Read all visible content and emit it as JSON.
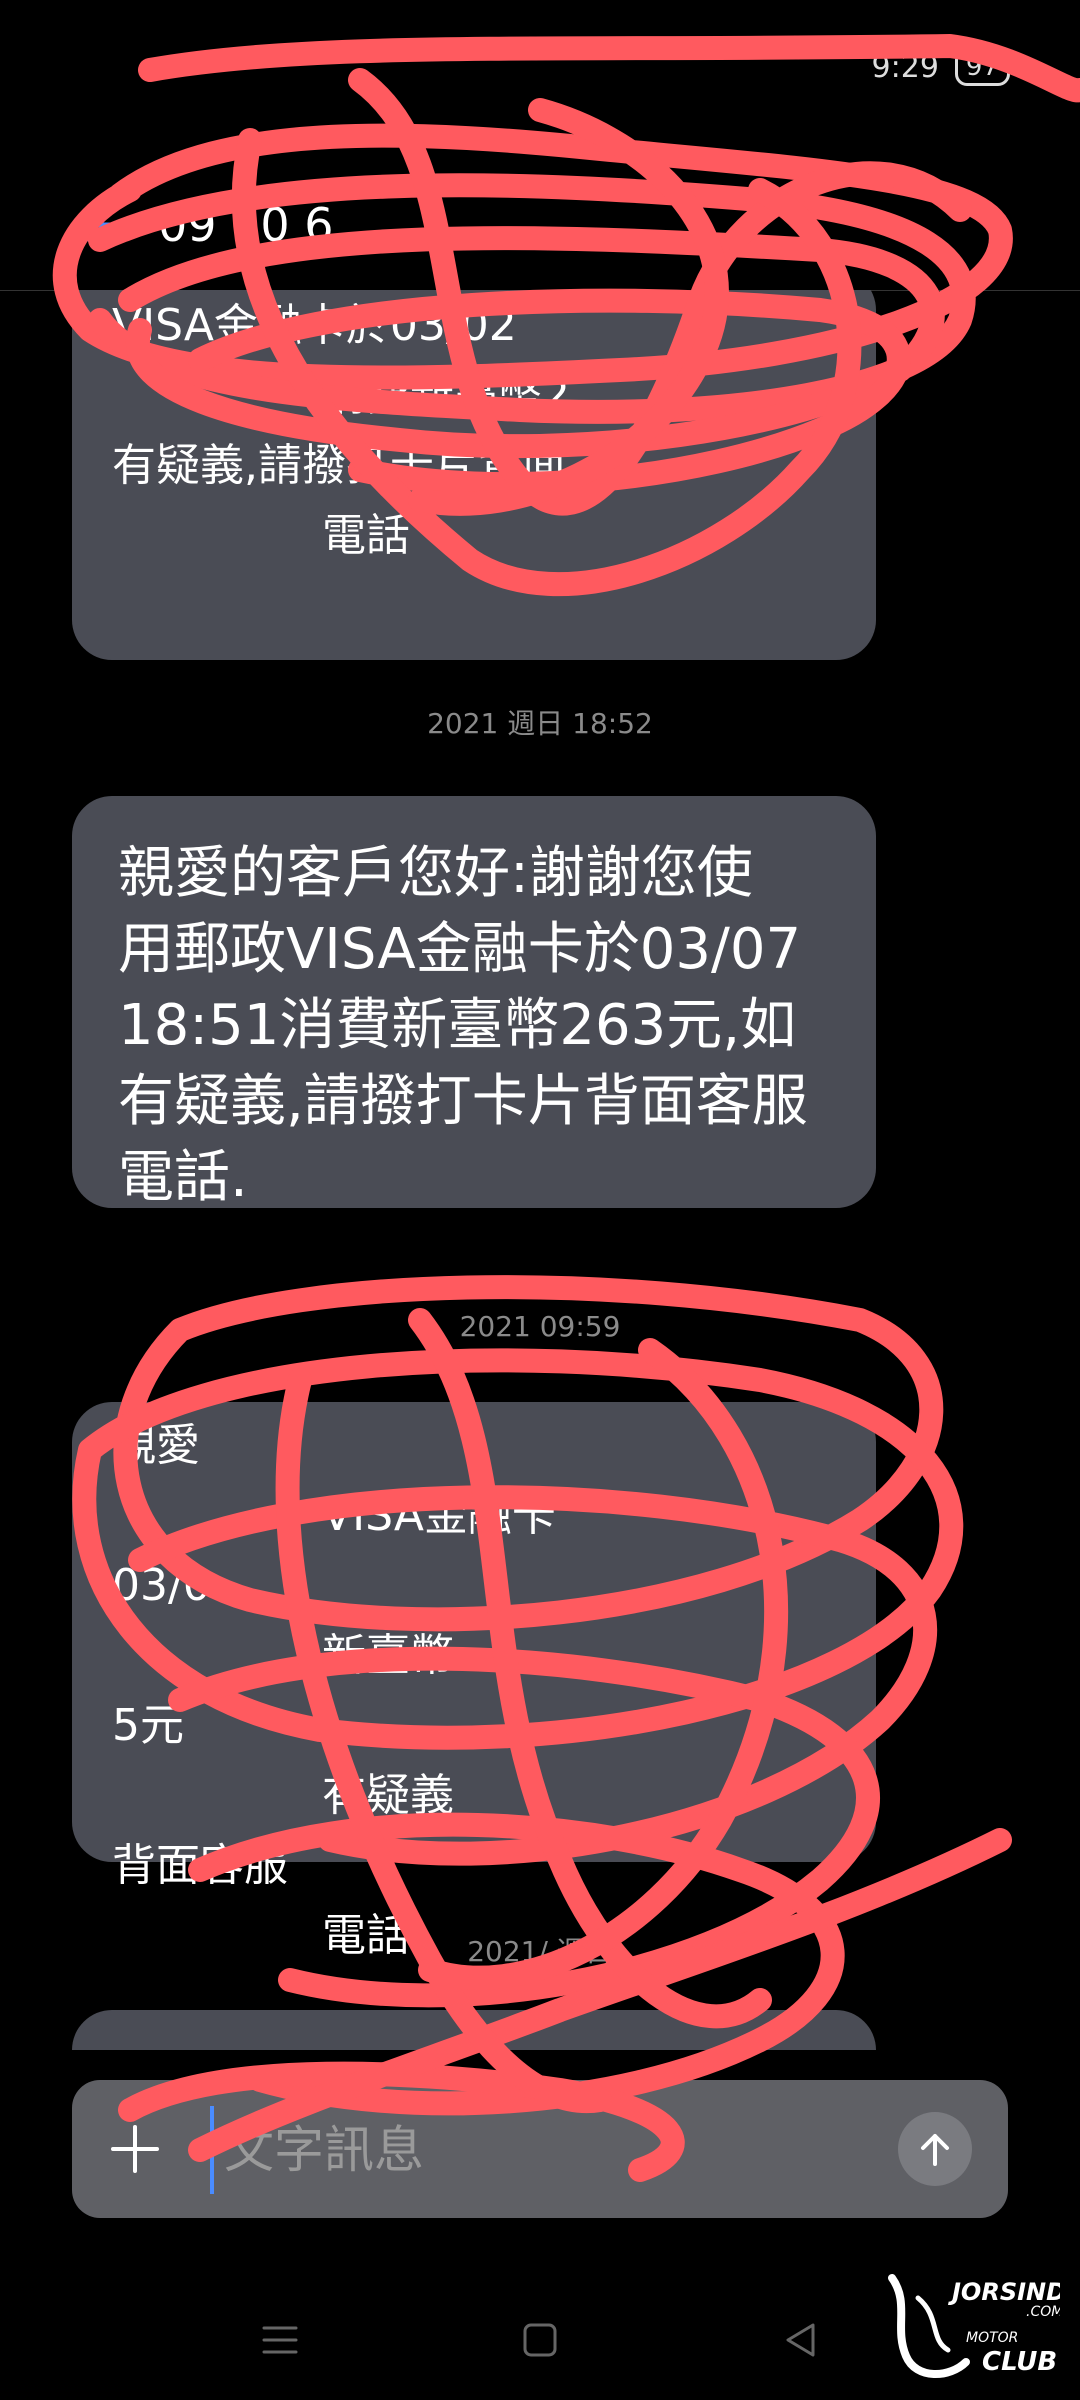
{
  "status_bar": {
    "time": "",
    "clock_short": "9:29",
    "battery": "97"
  },
  "app_bar": {
    "sender_partial": "09 10 6",
    "back_icon": "arrow-left-icon"
  },
  "messages": [
    {
      "text": "",
      "visible_fragments": [
        "VISA金融卡於03/02",
        "消費新臺幣2",
        "有疑義,請撥打卡片背面",
        "電話"
      ],
      "redacted": true
    },
    {
      "timestamp": "2021 週日 18:52",
      "text": "親愛的客戶您好:謝謝您使\n用郵政VISA金融卡於03/07\n18:51消費新臺幣263元,如\n有疑義,請撥打卡片背面客服\n電話.",
      "redacted": false
    },
    {
      "timestamp": "2021 09:59",
      "text": "",
      "visible_fragments": [
        "親愛",
        "VISA金融卡",
        "03/0",
        "新臺幣",
        "5元",
        "有疑義",
        "背面客服",
        "電話"
      ],
      "redacted": true
    },
    {
      "timestamp": "2021/ 週日",
      "text": "",
      "redacted": true
    }
  ],
  "composer": {
    "placeholder": "文字訊息",
    "add_icon": "plus-icon",
    "send_icon": "arrow-up-icon"
  },
  "nav_bar": {
    "menu_icon": "menu-icon",
    "home_icon": "square-icon",
    "back_icon": "triangle-back-icon"
  },
  "watermark": {
    "text": "JORSINDO.COM MOTOR CLUB"
  },
  "colors": {
    "background": "#000000",
    "bubble": "#4a4c55",
    "accent": "#4a8cff",
    "scribble": "#ff5a5f"
  }
}
